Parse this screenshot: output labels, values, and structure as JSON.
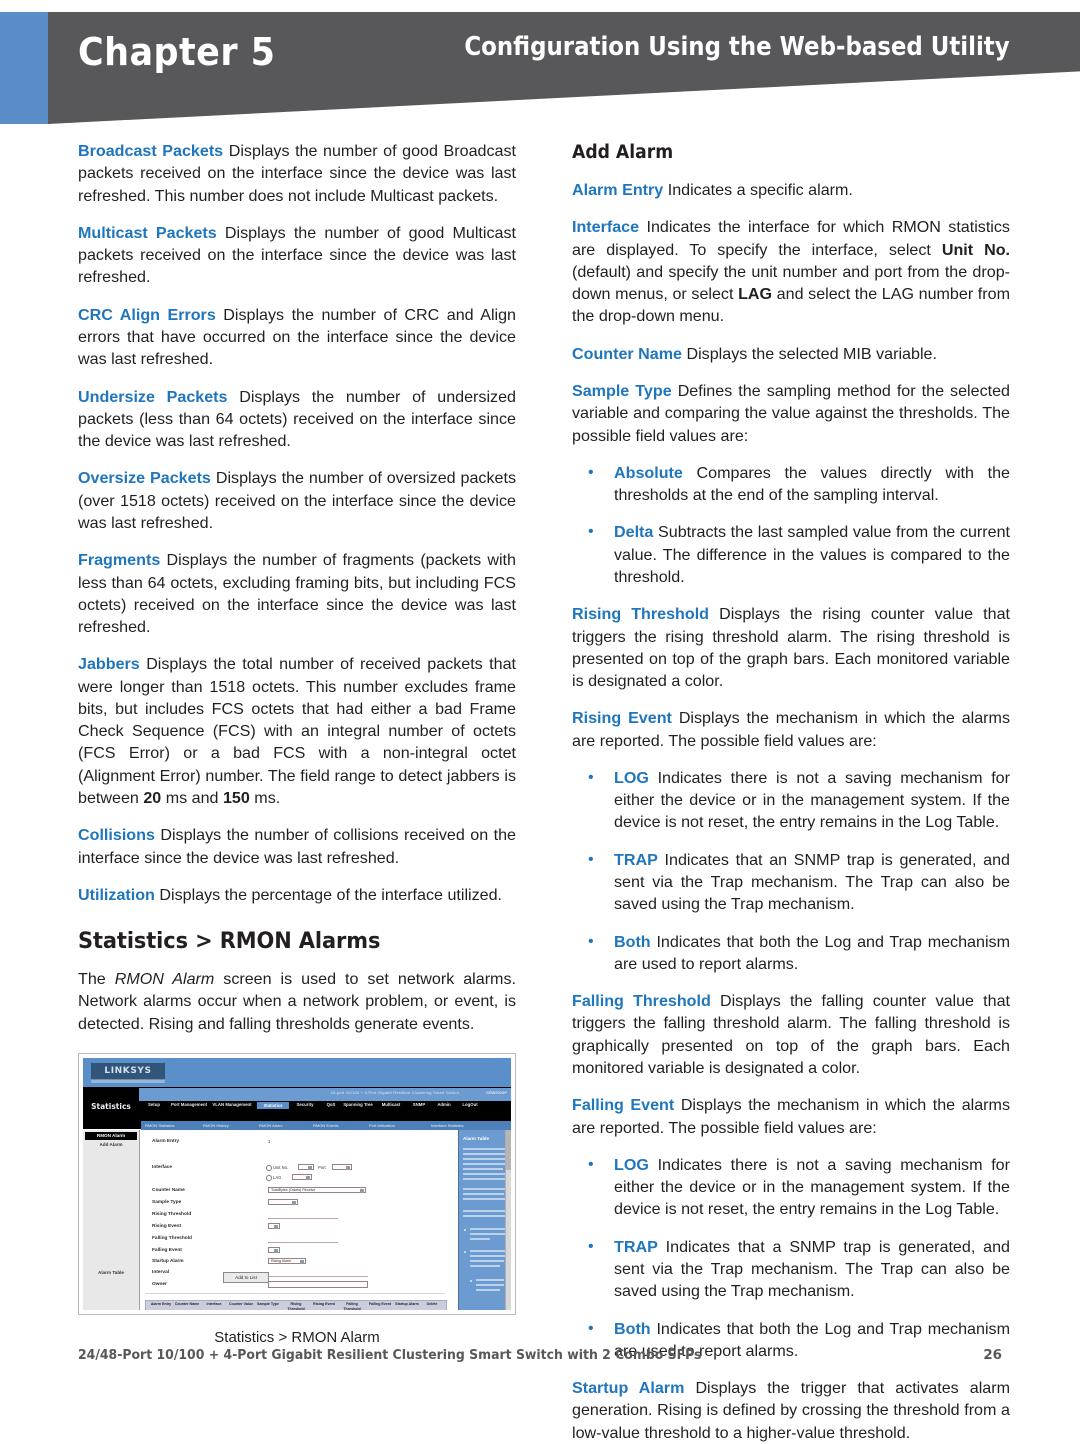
{
  "header": {
    "chapter_label": "Chapter 5",
    "section_title": "Configuration Using the Web-based Utility",
    "accent_blue": "#5a8cc8",
    "banner_gray": "#58585a"
  },
  "theme": {
    "term_blue": "#1f76bd",
    "body_text": "#231f20"
  },
  "left_column": {
    "paragraphs": [
      {
        "term": "Broadcast Packets",
        "text": "Displays the number of good Broadcast packets received on the interface since the device was last refreshed. This number does not include Multicast packets."
      },
      {
        "term": "Multicast Packets",
        "text": "Displays the number of good Multicast packets received on the interface since the device was last refreshed."
      },
      {
        "term": "CRC Align Errors",
        "text": "Displays the number of CRC and Align errors that have occurred on the interface since the device was last refreshed."
      },
      {
        "term": "Undersize Packets",
        "text": "Displays the number of undersized packets (less than 64 octets) received on the interface since the device was last refreshed."
      },
      {
        "term": "Oversize Packets",
        "text": "Displays the number of oversized packets (over 1518 octets) received on the interface since the device was last refreshed."
      },
      {
        "term": "Fragments",
        "text": "Displays the number of fragments (packets with less than 64 octets, excluding framing bits, but including FCS octets) received on the interface since the device was last refreshed."
      }
    ],
    "jabbers": {
      "term": "Jabbers",
      "text_part1": "Displays the total number of received packets that were longer than 1518 octets. This number excludes frame bits, but includes FCS octets that had either a bad Frame Check Sequence (FCS) with an integral number of octets (FCS Error) or a bad FCS with a non-integral octet (Alignment Error) number. The field range to detect jabbers is between ",
      "bold1": "20",
      "text_part2": " ms and ",
      "bold2": "150",
      "text_part3": " ms."
    },
    "paragraphs2": [
      {
        "term": "Collisions",
        "text": "Displays the number of collisions received on the interface since the device was last refreshed."
      },
      {
        "term": "Utilization",
        "text": "Displays the percentage of the interface utilized."
      }
    ],
    "heading": "Statistics > RMON Alarms",
    "intro": {
      "text_part1": "The ",
      "italic": "RMON Alarm",
      "text_part2": " screen is used to set network alarms. Network alarms occur when a network problem, or event, is detected. Rising and falling thresholds generate events."
    },
    "figure": {
      "caption": "Statistics > RMON Alarm",
      "screenshot": {
        "brand": "LINKSYS",
        "model_text": "24-port 10/100 + 4-Port Gigabit Resilient Clustering Smart Switch",
        "model_right": "SRW2024P",
        "left_title": "Statistics",
        "tabs": [
          "Setup",
          "Port Management",
          "VLAN Management",
          "Statistics",
          "Security",
          "QoS",
          "Spanning Tree",
          "Multicast",
          "SNMP",
          "Admin",
          "LogOut"
        ],
        "selected_tab": "Statistics",
        "subnav": [
          "RMON Statistics",
          "RMON History",
          "RMON Alarm",
          "RMON Events",
          "Port Utilization",
          "Interface Statistics"
        ],
        "sidebar": {
          "head": "RMON Alarm",
          "sub": "Add Alarm",
          "table_link": "Alarm Table"
        },
        "form_labels": [
          "Alarm Entry",
          "Interface",
          "Counter Name",
          "Sample Type",
          "Rising Threshold",
          "Rising Event",
          "Falling Threshold",
          "Falling Event",
          "Startup Alarm",
          "Interval",
          "Owner"
        ],
        "interface_radio1": "Unit No.",
        "interface_port": "Port",
        "interface_radio2": "LAG",
        "unit_value": "1",
        "port_value": "g1",
        "counter_name_value": "TotalBytes (Octets) Receive",
        "sample_type_value": "Absolute",
        "startup_alarm_value": "Rising Alarm",
        "add_button": "Add to List",
        "table_headers": [
          "Alarm Entry",
          "Counter Name",
          "Interface",
          "Counter Value",
          "Sample Type",
          "Rising Threshold",
          "Rising Event",
          "Falling Threshold",
          "Falling Event",
          "Startup Alarm",
          "Delete"
        ],
        "help_title": "Alarm Table"
      }
    }
  },
  "right_column": {
    "subheading": "Add Alarm",
    "alarm_entry": {
      "term": "Alarm Entry",
      "text": "Indicates a specific alarm."
    },
    "interface": {
      "term": "Interface",
      "text_part1": "Indicates the interface for which RMON statistics are displayed. To specify the interface, select ",
      "bold1": "Unit No.",
      "text_part2": " (default) and specify the unit number and port from the drop-down menus, or select ",
      "bold2": "LAG",
      "text_part3": " and select the LAG number from the drop-down menu."
    },
    "counter_name": {
      "term": "Counter Name",
      "text": "Displays the selected MIB variable."
    },
    "sample_type": {
      "term": "Sample Type",
      "text": "Defines the sampling method for the selected variable and comparing the value against the thresholds. The possible field values are:"
    },
    "sample_type_bullets": [
      {
        "term": "Absolute",
        "text": "Compares the values directly with the thresholds at the end of the sampling interval."
      },
      {
        "term": "Delta",
        "text": "Subtracts the last sampled value from the current value. The difference in the values is compared to the threshold."
      }
    ],
    "rising_threshold": {
      "term": "Rising Threshold",
      "text": "Displays the rising counter value that triggers the rising threshold alarm. The rising threshold is presented on top of the graph bars. Each monitored variable is designated a color."
    },
    "rising_event": {
      "term": "Rising Event",
      "text": "Displays the mechanism in which the alarms are reported. The possible field values are:"
    },
    "rising_event_bullets": [
      {
        "term": "LOG",
        "text": "Indicates there is not a saving mechanism for either the device or in the management system. If the device is not reset, the entry remains in the Log Table."
      },
      {
        "term": "TRAP",
        "text": "Indicates that an SNMP trap is generated, and sent via the Trap mechanism. The Trap can also be saved using the Trap mechanism."
      },
      {
        "term": "Both",
        "text": "Indicates that both the Log and Trap mechanism are used to report alarms."
      }
    ],
    "falling_threshold": {
      "term": "Falling Threshold",
      "text": "Displays the falling counter value that triggers the falling threshold alarm. The falling threshold is graphically presented on top of the graph bars. Each monitored variable is designated a color."
    },
    "falling_event": {
      "term": "Falling Event",
      "text": "Displays the mechanism in which the alarms are reported. The possible field values are:"
    },
    "falling_event_bullets": [
      {
        "term": "LOG",
        "text": "Indicates there is not a saving mechanism for either the device or in the management system. If the device is not reset, the entry remains in the Log Table."
      },
      {
        "term": "TRAP",
        "text": "Indicates that a SNMP trap is generated, and sent via the Trap mechanism. The Trap can also be saved using the Trap mechanism."
      },
      {
        "term": "Both",
        "text": "Indicates that both the Log and Trap mechanism are used to report alarms."
      }
    ],
    "startup_alarm": {
      "term": "Startup Alarm",
      "text": "Displays the trigger that activates alarm generation. Rising is defined by crossing the threshold from a low-value threshold to a higher-value threshold."
    }
  },
  "footer": {
    "product": "24/48-Port 10/100 + 4-Port Gigabit Resilient Clustering Smart Switch with 2 Combo SFPs",
    "page_number": "26"
  }
}
